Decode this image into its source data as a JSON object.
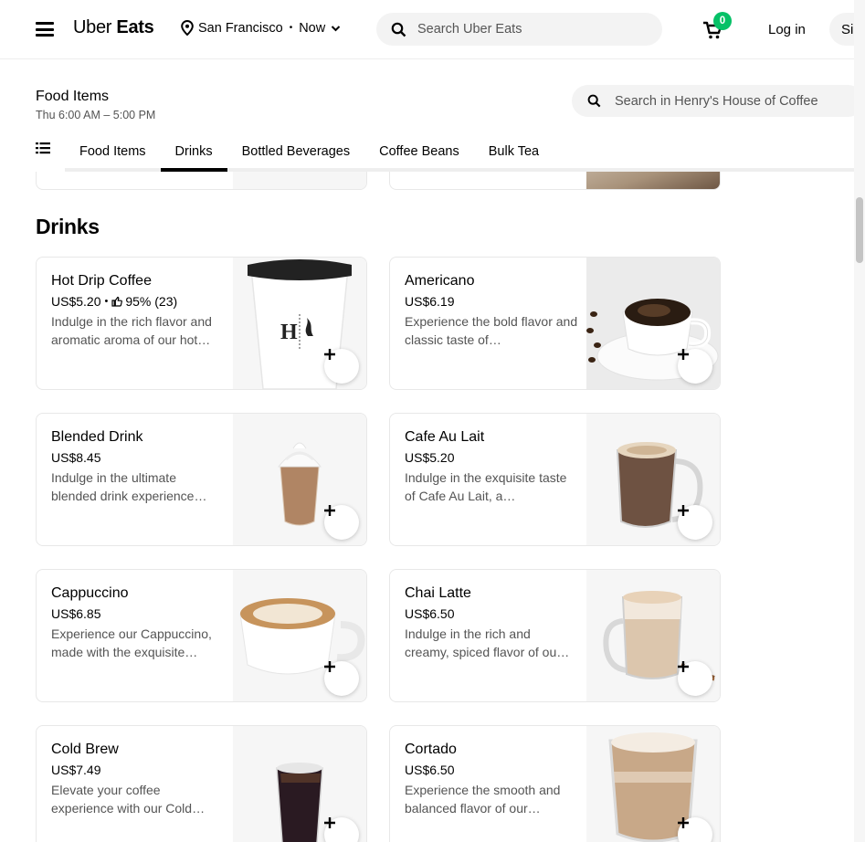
{
  "header": {
    "logo_light": "Uber",
    "logo_bold": "Eats",
    "location": "San Francisco",
    "separator": "•",
    "time": "Now",
    "search_placeholder": "Search Uber Eats",
    "cart_count": "0",
    "login_label": "Log in",
    "signup_label": "Si"
  },
  "store": {
    "menu_title": "Food Items",
    "hours": "Thu 6:00 AM – 5:00 PM",
    "search_placeholder": "Search in Henry's House of Coffee",
    "tabs": [
      "Food Items",
      "Drinks",
      "Bottled Beverages",
      "Coffee Beans",
      "Bulk Tea"
    ],
    "active_tab": "Drinks"
  },
  "section": {
    "title": "Drinks",
    "items": [
      {
        "name": "Hot Drip Coffee",
        "price": "US$5.20",
        "rating_sep": "•",
        "rating": "95% (23)",
        "desc": "Indulge in the rich flavor and aromatic aroma of our hot…"
      },
      {
        "name": "Americano",
        "price": "US$6.19",
        "desc": "Experience the bold flavor and classic taste of…"
      },
      {
        "name": "Blended Drink",
        "price": "US$8.45",
        "desc": "Indulge in the ultimate blended drink experience…"
      },
      {
        "name": "Cafe Au Lait",
        "price": "US$5.20",
        "desc": "Indulge in the exquisite taste of Cafe Au Lait, a…"
      },
      {
        "name": "Cappuccino",
        "price": "US$6.85",
        "desc": "Experience our Cappuccino, made with the exquisite…"
      },
      {
        "name": "Chai Latte",
        "price": "US$6.50",
        "desc": "Indulge in the rich and creamy, spiced flavor of ou…"
      },
      {
        "name": "Cold Brew",
        "price": "US$7.49",
        "desc": "Elevate your coffee experience with our Cold…"
      },
      {
        "name": "Cortado",
        "price": "US$6.50",
        "desc": "Experience the smooth and balanced flavor of our…"
      }
    ]
  },
  "cup_logo": "H",
  "colors": {
    "accent": "#06c167",
    "muted_text": "#545454",
    "surface": "#f3f3f3"
  },
  "icons": [
    "menu-icon",
    "location-pin-icon",
    "chevron-down-icon",
    "search-icon",
    "cart-icon",
    "list-icon",
    "thumbs-up-icon",
    "plus-icon"
  ]
}
